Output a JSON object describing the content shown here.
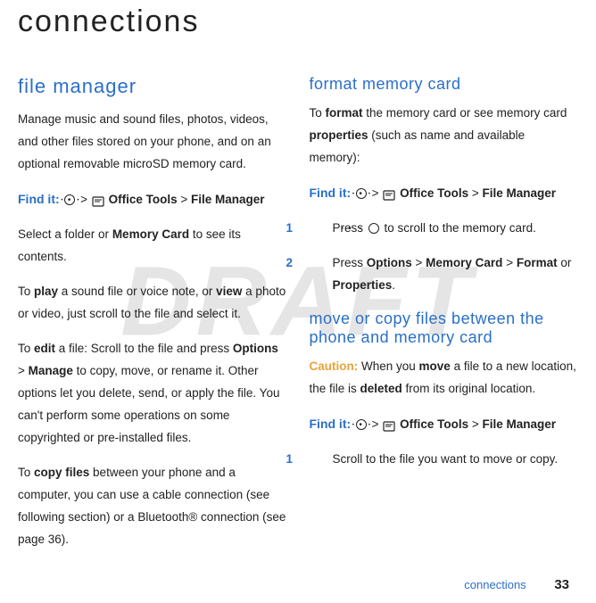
{
  "watermark": "DRAFT",
  "page_title": "connections",
  "left": {
    "h2": "file manager",
    "p1": "Manage music and sound files, photos, videos, and other files stored on your phone, and on an optional removable microSD memory card.",
    "findit_label": "Find it:",
    "findit_path_tools": "Office Tools",
    "findit_path_fm": "File Manager",
    "p2a": "Select a folder or ",
    "memcard": "Memory Card",
    "p2b": " to see its contents.",
    "p3a": "To ",
    "play": "play",
    "p3b": " a sound file or voice note, or ",
    "view": "view",
    "p3c": " a photo or video, just scroll to the file and select it.",
    "p4a": "To ",
    "edit": "edit",
    "p4b": " a file: Scroll to the file and press ",
    "options": "Options",
    "p4c": " > ",
    "manage": "Manage",
    "p4d": " to copy, move, or rename it. Other options let you delete, send, or apply the file. You can't perform some operations on some copyrighted or pre-installed files.",
    "p5a": "To ",
    "copyfiles": "copy files",
    "p5b": " between your phone and a computer, you can use a cable connection (see following section) or a Bluetooth® connection (see page 36)."
  },
  "right": {
    "h3a": "format memory card",
    "r1a": "To ",
    "format": "format",
    "r1b": " the memory card or see memory card ",
    "properties": "properties",
    "r1c": " (such as name and available memory):",
    "findit_label": "Find it:",
    "findit_tools": "Office Tools",
    "findit_fm": "File Manager",
    "step1_num": "1",
    "step1a": "Press ",
    "step1b": " to scroll to the memory card.",
    "step2_num": "2",
    "step2a": "Press ",
    "s2_options": "Options",
    "s2_memcard": "Memory Card",
    "s2_format": "Format",
    "s2_or": " or ",
    "s2_properties": "Properties",
    "h3b": "move or copy files between the phone and memory card",
    "caution_label": "Caution:",
    "caution_a": " When you ",
    "move": "move",
    "caution_b": " a file to a new location, the file is ",
    "deleted": "deleted",
    "caution_c": " from its original location.",
    "findit2_label": "Find it:",
    "step3_num": "1",
    "step3": "Scroll to the file you want to move or copy."
  },
  "footer": {
    "text": "connections",
    "page": "33"
  }
}
